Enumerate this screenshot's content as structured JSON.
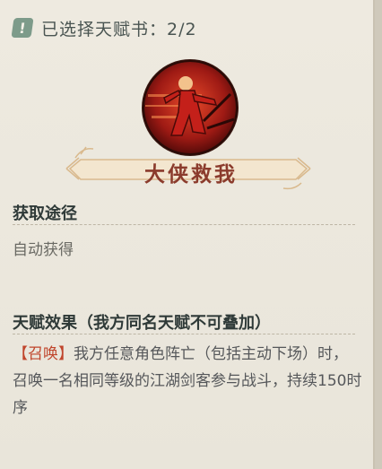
{
  "header": {
    "text": "已选择天赋书：2/2",
    "icon": "exclamation-icon"
  },
  "talent": {
    "name": "大侠救我",
    "portrait_icon": "warrior-portrait-icon"
  },
  "source": {
    "title": "获取途径",
    "value": "自动获得"
  },
  "effect": {
    "title": "天赋效果（我方同名天赋不可叠加）",
    "tag": "【召唤】",
    "description": "我方任意角色阵亡（包括主动下场）时，召唤一名相同等级的江湖剑客参与战斗，持续150时序"
  },
  "colors": {
    "tag": "#c0452c",
    "title": "#8b3b2c",
    "icon_bg": "#7d9b8a"
  }
}
